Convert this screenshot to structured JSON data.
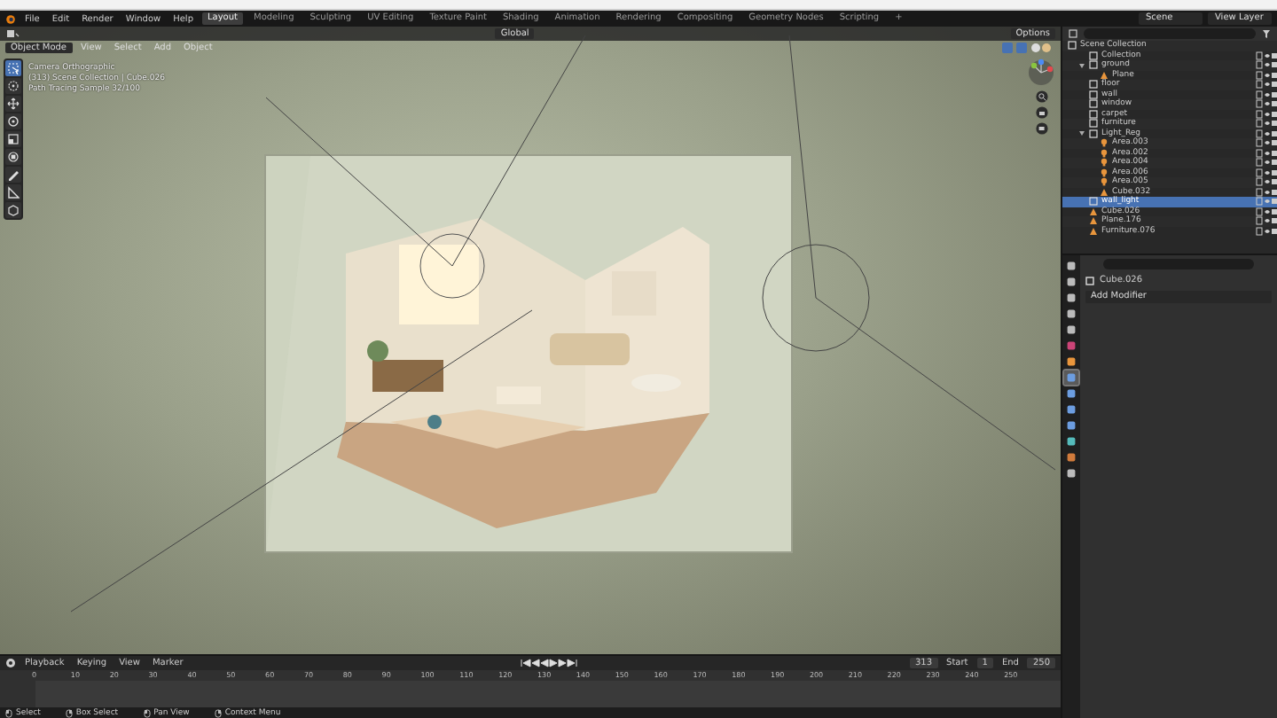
{
  "menu": [
    "File",
    "Edit",
    "Render",
    "Window",
    "Help"
  ],
  "workspaces": [
    {
      "label": "Layout",
      "selected": true
    },
    {
      "label": "Modeling",
      "selected": false
    },
    {
      "label": "Sculpting",
      "selected": false
    },
    {
      "label": "UV Editing",
      "selected": false
    },
    {
      "label": "Texture Paint",
      "selected": false
    },
    {
      "label": "Shading",
      "selected": false
    },
    {
      "label": "Animation",
      "selected": false
    },
    {
      "label": "Rendering",
      "selected": false
    },
    {
      "label": "Compositing",
      "selected": false
    },
    {
      "label": "Geometry Nodes",
      "selected": false
    },
    {
      "label": "Scripting",
      "selected": false
    },
    {
      "label": "+",
      "selected": false
    }
  ],
  "scene": "Scene",
  "view_layer": "View Layer",
  "tool_header": {
    "orientation": "Global",
    "options": "Options"
  },
  "viewport_header": {
    "mode": "Object Mode",
    "menus": [
      "View",
      "Select",
      "Add",
      "Object"
    ]
  },
  "overlay_text": [
    "Camera Orthographic",
    "(313) Scene Collection | Cube.026",
    "Path Tracing Sample 32/100"
  ],
  "tools": [
    {
      "kind": "select",
      "selected": true
    },
    {
      "kind": "cursor",
      "selected": false
    },
    {
      "kind": "move",
      "selected": false
    },
    {
      "kind": "rotate",
      "selected": false
    },
    {
      "kind": "scale",
      "selected": false
    },
    {
      "kind": "transform",
      "selected": false
    },
    {
      "kind": "annotate",
      "selected": false
    },
    {
      "kind": "measure",
      "selected": false
    },
    {
      "kind": "add",
      "selected": false
    }
  ],
  "viewport": {
    "render": {
      "kind": "picture"
    }
  },
  "outliner": {
    "root": "Scene Collection",
    "items": [
      {
        "name": "Collection",
        "kind": "collection",
        "selected": false
      },
      {
        "name": "ground",
        "kind": "collection",
        "selected": false,
        "expanded": true,
        "children": [
          {
            "name": "Plane",
            "kind": "mesh",
            "selected": false
          }
        ]
      },
      {
        "name": "floor",
        "kind": "collection",
        "selected": false
      },
      {
        "name": "wall",
        "kind": "collection",
        "selected": false
      },
      {
        "name": "window",
        "kind": "collection",
        "selected": false
      },
      {
        "name": "carpet",
        "kind": "collection",
        "selected": false
      },
      {
        "name": "furniture",
        "kind": "collection",
        "selected": false
      },
      {
        "name": "Light_Reg",
        "kind": "collection",
        "selected": false,
        "expanded": true,
        "children": [
          {
            "name": "Area.003",
            "kind": "light",
            "selected": false
          },
          {
            "name": "Area.002",
            "kind": "light",
            "selected": false
          },
          {
            "name": "Area.004",
            "kind": "light",
            "selected": false
          },
          {
            "name": "Area.006",
            "kind": "light",
            "selected": false
          },
          {
            "name": "Area.005",
            "kind": "light",
            "selected": false
          },
          {
            "name": "Cube.032",
            "kind": "mesh",
            "selected": false
          }
        ]
      },
      {
        "name": "wall_light",
        "kind": "collection",
        "selected": true
      },
      {
        "name": "Cube.026",
        "kind": "mesh",
        "selected": false
      },
      {
        "name": "Plane.176",
        "kind": "mesh",
        "selected": false
      },
      {
        "name": "Furniture.076",
        "kind": "mesh",
        "selected": false
      }
    ]
  },
  "properties": {
    "tabs": [
      {
        "kind": "tool",
        "selected": false
      },
      {
        "kind": "render",
        "selected": false
      },
      {
        "kind": "output",
        "selected": false
      },
      {
        "kind": "view",
        "selected": false
      },
      {
        "kind": "scene",
        "selected": false
      },
      {
        "kind": "world",
        "selected": false
      },
      {
        "kind": "object",
        "selected": false
      },
      {
        "kind": "modifier",
        "selected": true
      },
      {
        "kind": "particles",
        "selected": false
      },
      {
        "kind": "physics",
        "selected": false
      },
      {
        "kind": "constraints",
        "selected": false
      },
      {
        "kind": "data",
        "selected": false
      },
      {
        "kind": "material",
        "selected": false
      },
      {
        "kind": "texture",
        "selected": false
      }
    ],
    "object_name": "Cube.026",
    "add_button": "Add Modifier"
  },
  "timeline": {
    "menus": [
      "Playback",
      "Keying",
      "View",
      "Marker"
    ],
    "current_frame": "313",
    "start_label": "Start",
    "start": "1",
    "end_label": "End",
    "end": "250",
    "ticks": [
      "0",
      "10",
      "20",
      "30",
      "40",
      "50",
      "60",
      "70",
      "80",
      "90",
      "100",
      "110",
      "120",
      "130",
      "140",
      "150",
      "160",
      "170",
      "180",
      "190",
      "200",
      "210",
      "220",
      "230",
      "240",
      "250"
    ]
  },
  "status_bar": [
    "Select",
    "Box Select",
    "Pan View",
    "Context Menu"
  ]
}
